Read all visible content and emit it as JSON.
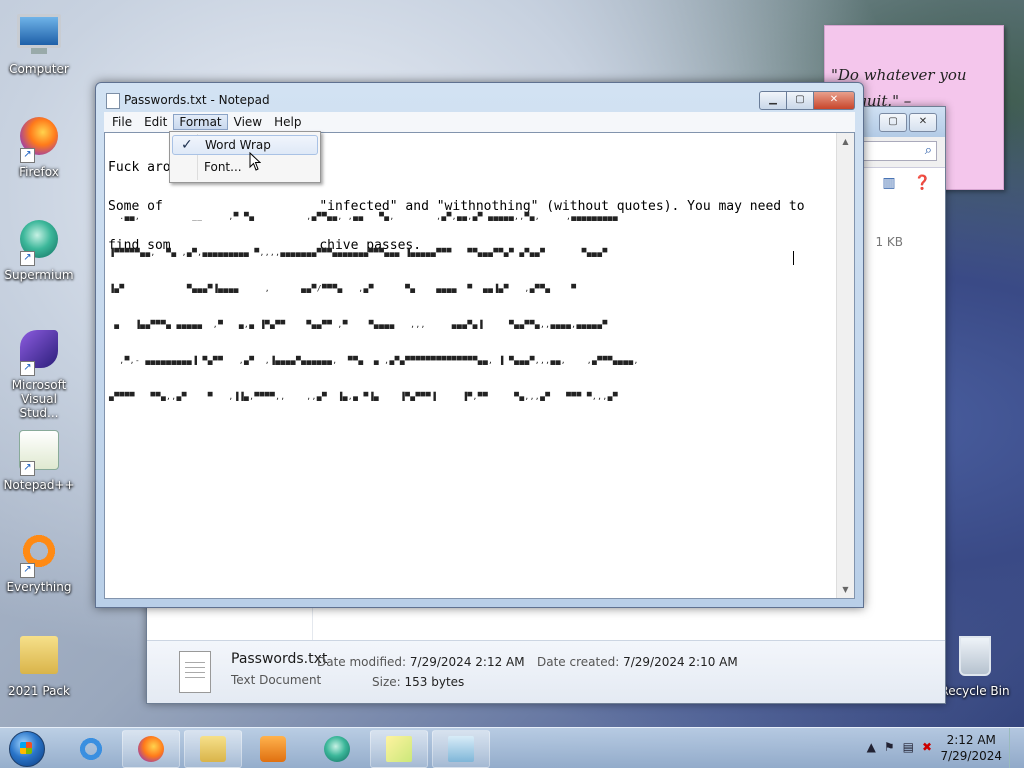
{
  "desktop": {
    "icons": [
      {
        "label": "Computer"
      },
      {
        "label": "Firefox"
      },
      {
        "label": "Supermium"
      },
      {
        "label": "Microsoft Visual Stud..."
      },
      {
        "label": "Notepad++"
      },
      {
        "label": "Everything"
      },
      {
        "label": "2021 Pack"
      },
      {
        "label": "Recycle Bin"
      }
    ]
  },
  "sticky_note": {
    "line1": "\"Do whatever you",
    "line2": "t. I quit.\" –"
  },
  "explorer": {
    "size_value": "1 KB",
    "details": {
      "name": "Passwords.txt",
      "type": "Text Document",
      "date_modified_label": "Date modified:",
      "date_modified": "7/29/2024 2:12 AM",
      "size_label": "Size:",
      "size": "153 bytes",
      "date_created_label": "Date created:",
      "date_created": "7/29/2024 2:10 AM"
    }
  },
  "notepad": {
    "title": "Passwords.txt - Notepad",
    "menu": {
      "file": "File",
      "edit": "Edit",
      "format": "Format",
      "view": "View",
      "help": "Help"
    },
    "text_lines": [
      "Fuck aro",
      "Some of                    \"infected\" and \"withnothing\" (without quotes). You may need to",
      "find som                   chive passes."
    ],
    "ascii_art": [
      "  .▄▄,          __     ,▀ ▀▄          ,▄▀▀▄▄, ,▄▄   ▀▄,        ,▄▀,▄▄,▄▀ ▄▄▄▄▄,,▀▄,     ,▄▄▄▄▄▄▄▄▄",
      "▐▀▀▀▀▀▄▄,  ▀▄ ,▄▀,▄▄▄▄▄▄▄▄▄ ▀,,,,▄▄▄▄▄▄▄▀▀▀▄▄▄▄▄▄▄▀▀▀▄▄▄ ▐▄▄▄▄▄▀▀▀   ▀▀▄▄▄▀▀▄▀ ▄▀▄▄▀       ▀▄▄▄▀",
      "▐▄▀            ▀▄▄▄▀▐▄▄▄▄     ,      ▄▄▀/▀▀▀▄   ,▄▀      ▀▄    ▄▄▄▄  ▀  ▄▄▐▄▀   ,▄▀▀▄    ▀",
      " ▄   ▐▄▄▀▀▀▄ ▄▄▄▄▄  ,▀   ▄,▄ ▐▀▄▀▀    ▀▄▄▀▀ ,▀    ▀▄▄▄▄   ,,,     ▄▄▄▀▄▐     ▀▄▄▀▀▄,,▄▄▄▄,▄▄▄▄▄▀",
      "  ,▀,- ▄▄▄▄▄▄▄▄▄▐ ▀▄▀▀   ,▄▀  ,▐▄▄▄▄▀▄▄▄▄▄▄,  ▀▀▄  ▄ ,▄▀▄▀▀▀▀▀▀▀▀▀▀▀▀▀▀▄▄, ▐ ▀▄▄▄▀,,,▄▄,    ,▄▀▀▀▄▄▄▄,",
      "▄▀▀▀▀   ▀▀▄,,▄▀    ▀   ,▐▐▄,▀▀▀▀,,    ,,▄▀  ▐▄,▄ ▀▐▄    ▐▀▄▀▀▀▐     ▐▀,▀▀     ▀▄,,,▄▀   ▀▀▀ ▀,,,▄▀"
    ]
  },
  "format_menu": {
    "word_wrap": "Word Wrap",
    "word_wrap_checked": true,
    "font": "Font..."
  },
  "taskbar": {
    "time": "2:12 AM",
    "date": "7/29/2024"
  },
  "colors": {
    "close_button": "#c8452b",
    "sticky": "#f4c6ec",
    "taskbar": "#a9c0dc"
  }
}
